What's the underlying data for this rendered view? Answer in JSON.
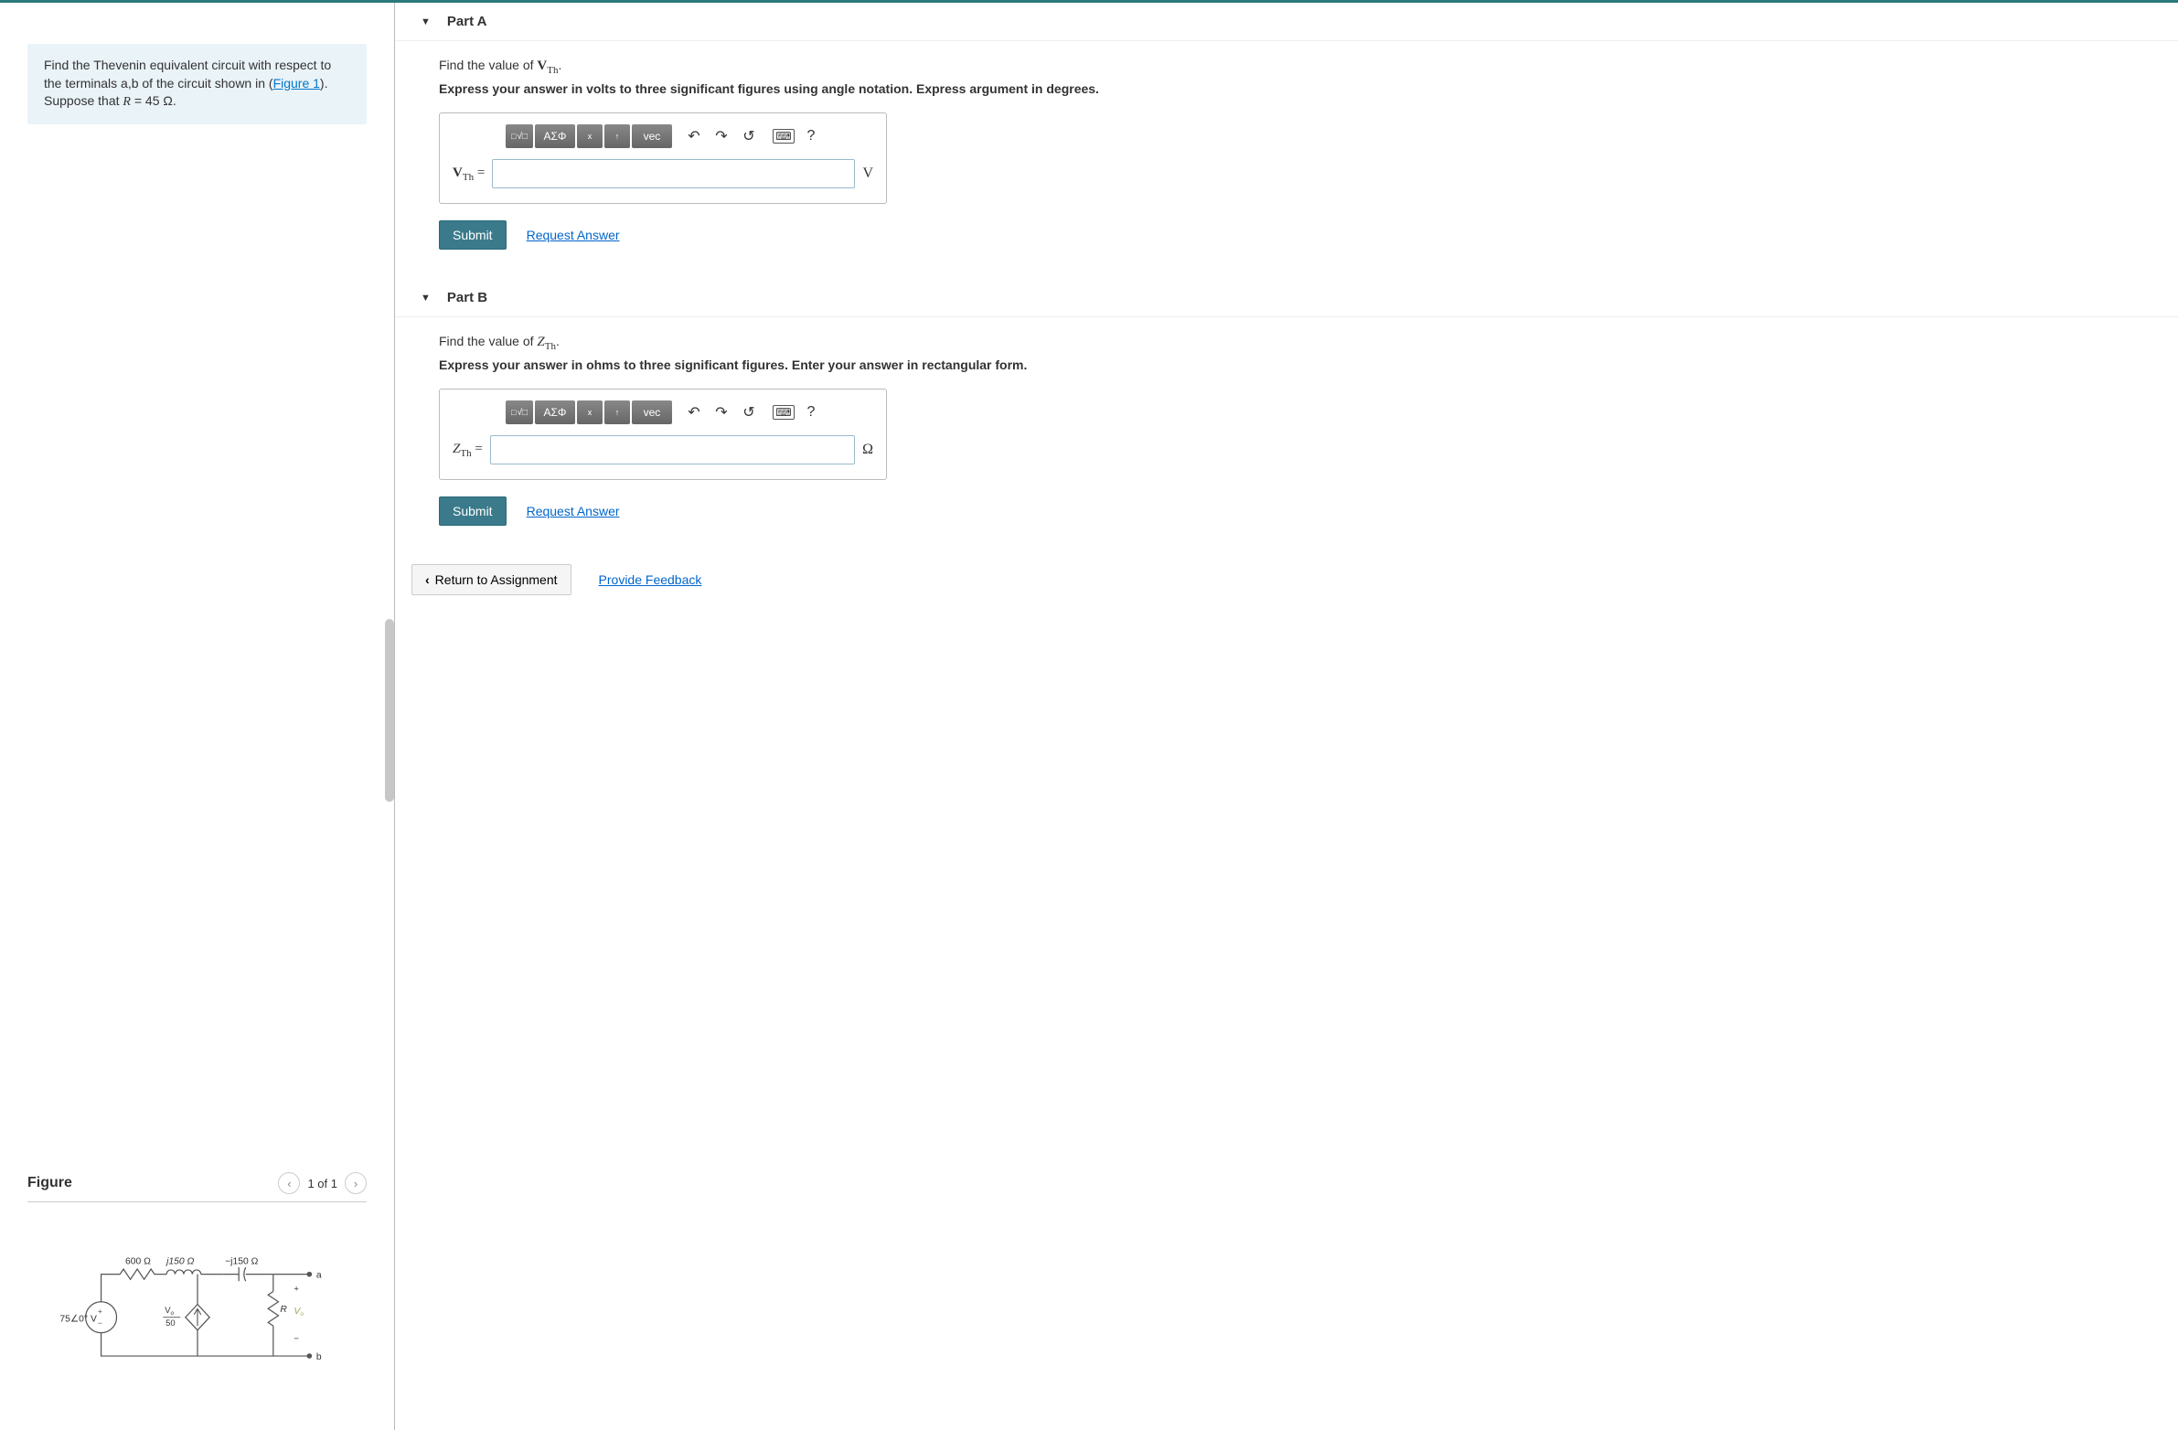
{
  "problem": {
    "text_pre": "Find the Thevenin equivalent circuit with respect to the terminals a,b of the circuit shown in (",
    "figure_link": "Figure 1",
    "text_post": "). Suppose that ",
    "var": "R",
    "eq": " = 45 Ω."
  },
  "figure": {
    "title": "Figure",
    "pager": "1 of 1",
    "labels": {
      "src": "75∠0° V",
      "r1": "600 Ω",
      "jl": "j150 Ω",
      "cap": "−j150 Ω",
      "dep": "V",
      "dep_sub": "o",
      "dep_den": "50",
      "R": "R",
      "Vo": "V",
      "Vo_sub": "o",
      "a": "a",
      "b": "b",
      "plus": "+",
      "minus": "−"
    }
  },
  "partA": {
    "title": "Part A",
    "prompt_pre": "Find the value of ",
    "prompt_var": "V",
    "prompt_sub": "Th",
    "prompt_post": ".",
    "instruct": "Express your answer in volts to three significant figures using angle notation. Express argument in degrees.",
    "lhs_var": "V",
    "lhs_sub": "Th",
    "lhs_eq": " = ",
    "unit": "V",
    "submit": "Submit",
    "request": "Request Answer",
    "tb_greek": "ΑΣΦ",
    "tb_vec": "vec"
  },
  "partB": {
    "title": "Part B",
    "prompt_pre": "Find the value of ",
    "prompt_var": "Z",
    "prompt_sub": "Th",
    "prompt_post": ".",
    "instruct": "Express your answer in ohms to three significant figures. Enter your answer in rectangular form.",
    "lhs_var": "Z",
    "lhs_sub": "Th",
    "lhs_eq": " = ",
    "unit": "Ω",
    "submit": "Submit",
    "request": "Request Answer",
    "tb_greek": "ΑΣΦ",
    "tb_vec": "vec"
  },
  "footer": {
    "return": "Return to Assignment",
    "feedback": "Provide Feedback"
  },
  "tool_symbols": {
    "templates": "√",
    "xfrac": "x",
    "sub": "↑",
    "undo": "↶",
    "redo": "↷",
    "reset": "↺",
    "kbd": "⌨",
    "help": "?"
  }
}
